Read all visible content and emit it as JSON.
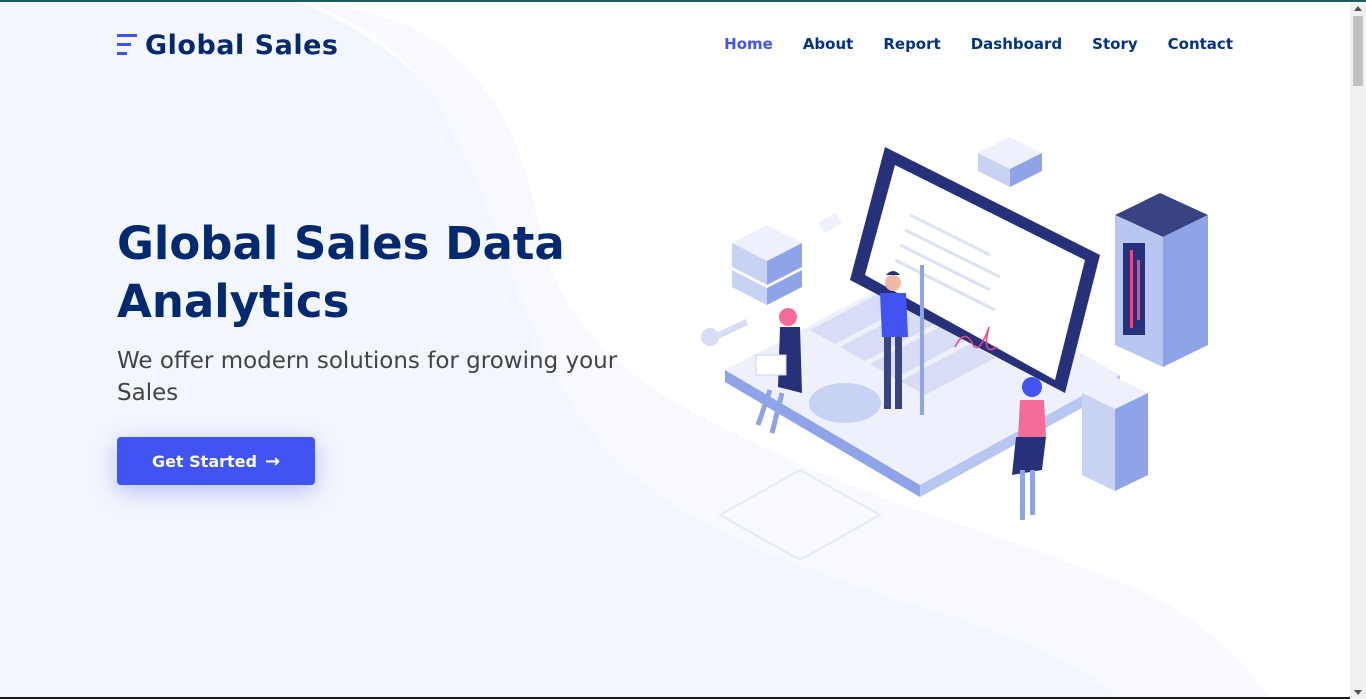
{
  "site": {
    "brand_name": "Global Sales",
    "nav": [
      {
        "label": "Home",
        "active": true
      },
      {
        "label": "About",
        "active": false
      },
      {
        "label": "Report",
        "active": false
      },
      {
        "label": "Dashboard",
        "active": false
      },
      {
        "label": "Story",
        "active": false
      },
      {
        "label": "Contact",
        "active": false
      }
    ]
  },
  "hero": {
    "title_line1": "Global Sales Data",
    "title_line2": "Analytics",
    "subtitle": "We offer modern solutions for growing your Sales",
    "cta_label": "Get Started",
    "cta_icon": "arrow-right-icon"
  },
  "illustration": {
    "name": "data-analytics-isometric-illustration"
  },
  "colors": {
    "brand_dark": "#012970",
    "nav_text": "#013289",
    "accent": "#4154f1",
    "hero_bg": "#f2f5fd",
    "text_muted": "#444444"
  }
}
